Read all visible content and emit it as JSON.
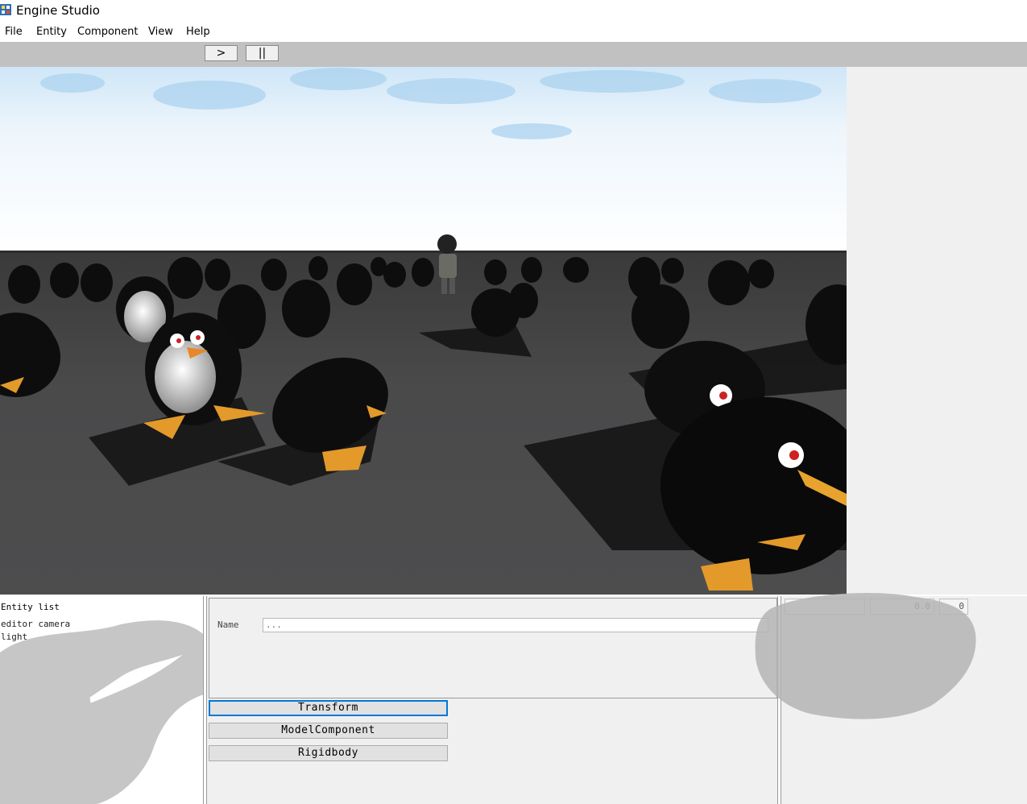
{
  "window": {
    "title": "Engine Studio"
  },
  "menu": {
    "items": [
      "File",
      "Entity",
      "Component",
      "View",
      "Help"
    ]
  },
  "toolbar": {
    "play_label": ">",
    "pause_label": "||"
  },
  "entity_panel": {
    "title": "Entity list",
    "items": [
      "editor camera",
      "light",
      "",
      "",
      ""
    ]
  },
  "inspector": {
    "name_label": "Name",
    "name_value": "...",
    "components": [
      "Transform",
      "ModelComponent",
      "Rigidbody"
    ]
  },
  "properties": {
    "fields": [
      "",
      "0.0",
      "0"
    ]
  },
  "colors": {
    "focus_accent": "#0078d7",
    "toolbar_bg": "#c1c1c1",
    "panel_bg": "#f0f0f0"
  }
}
